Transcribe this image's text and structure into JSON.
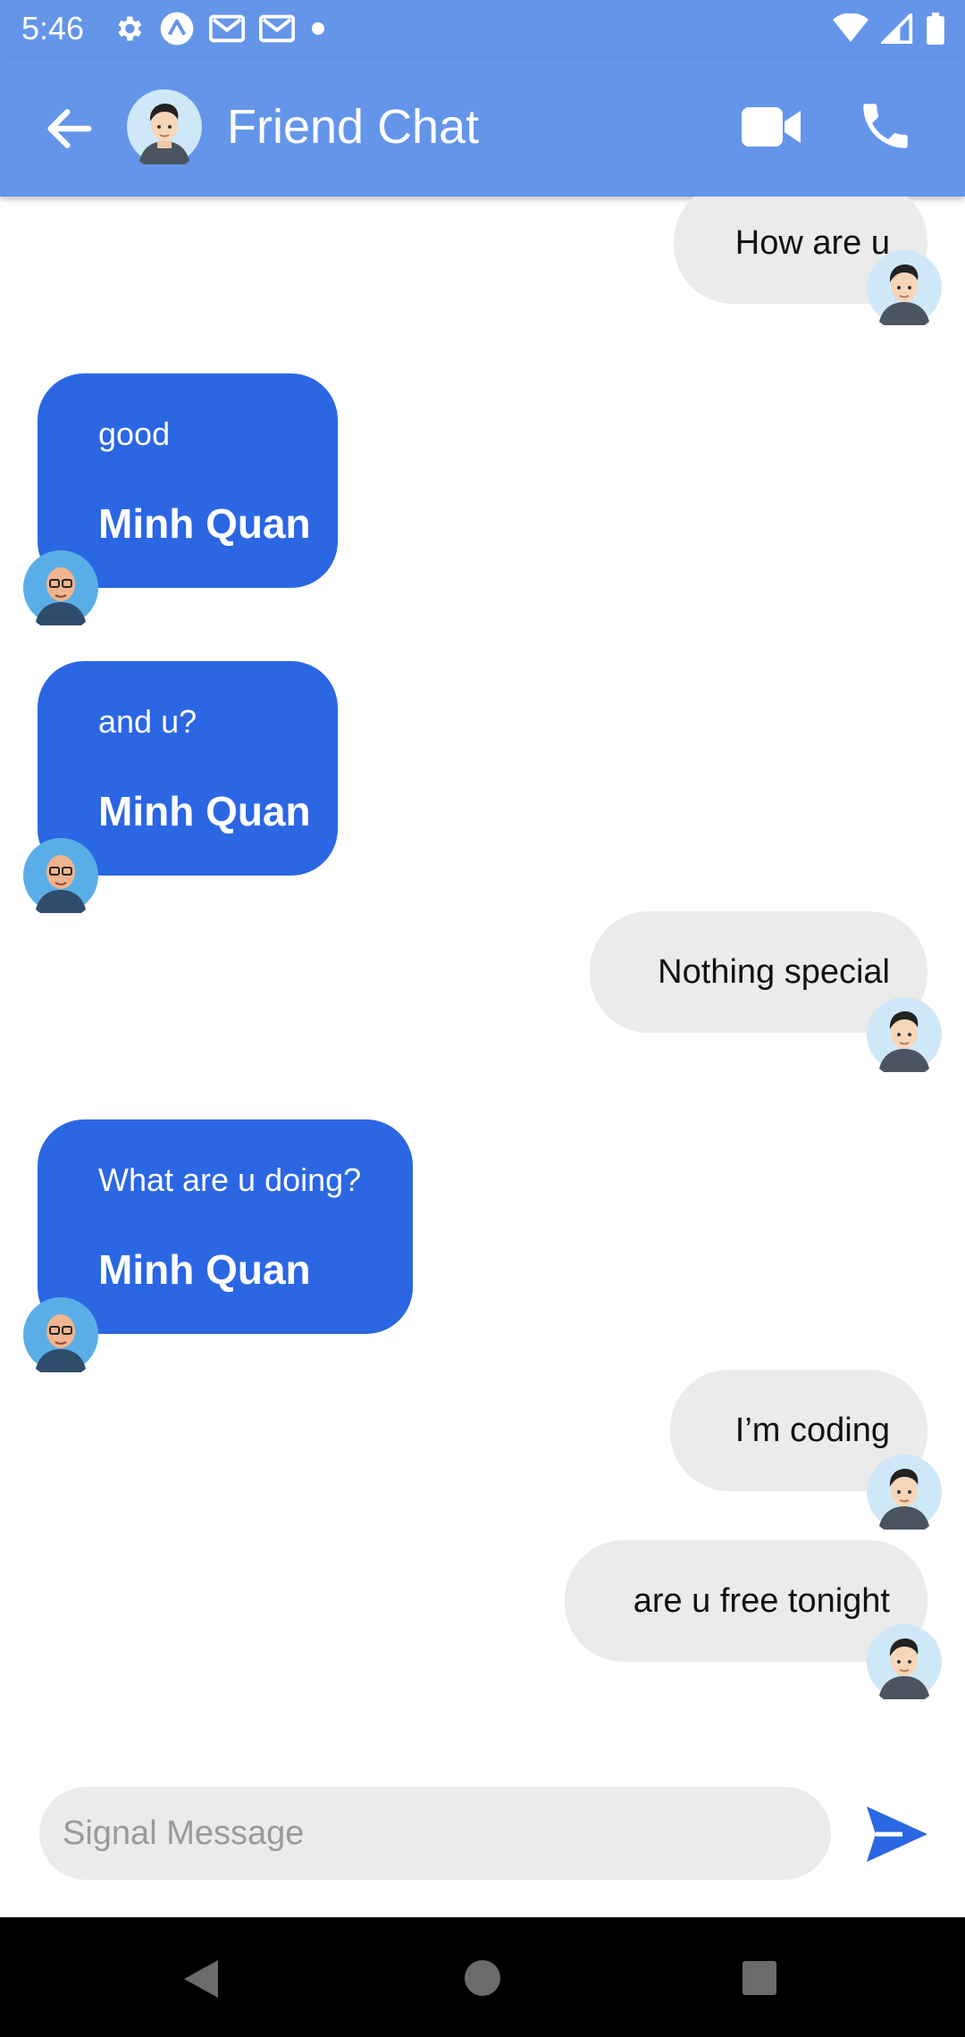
{
  "status_bar": {
    "time": "5:46",
    "icons_left": [
      "gear-icon",
      "expo-icon",
      "gmail-icon",
      "gmail-icon",
      "dot-icon"
    ],
    "icons_right": [
      "wifi-icon",
      "signal-icon",
      "battery-icon"
    ]
  },
  "header": {
    "title": "Friend Chat",
    "avatar": "male-avatar-icon",
    "actions": [
      "video-call-icon",
      "phone-icon"
    ],
    "color": "#6495e8"
  },
  "messages": [
    {
      "side": "outgoing",
      "text": "How are u"
    },
    {
      "side": "incoming",
      "text": "good",
      "sender": "Minh Quan"
    },
    {
      "side": "incoming",
      "text": "and u?",
      "sender": "Minh Quan"
    },
    {
      "side": "outgoing",
      "text": "Nothing special"
    },
    {
      "side": "incoming",
      "text": "What are u doing?",
      "sender": "Minh Quan"
    },
    {
      "side": "outgoing",
      "text": "I’m coding"
    },
    {
      "side": "outgoing",
      "text": "are u free tonight"
    }
  ],
  "composer": {
    "placeholder": "Signal Message",
    "value": "",
    "send_icon": "send-icon"
  },
  "colors": {
    "incoming_bubble": "#2b66e3",
    "outgoing_bubble": "#ebebeb"
  }
}
